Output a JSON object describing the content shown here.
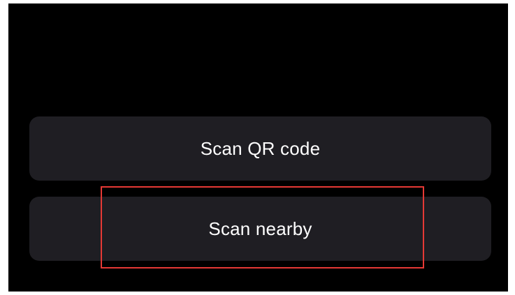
{
  "actions": {
    "scan_qr_label": "Scan QR code",
    "scan_nearby_label": "Scan nearby"
  },
  "colors": {
    "screen_background": "#000000",
    "button_background": "#1f1e23",
    "button_text": "#ffffff",
    "highlight_border": "#e53935"
  }
}
